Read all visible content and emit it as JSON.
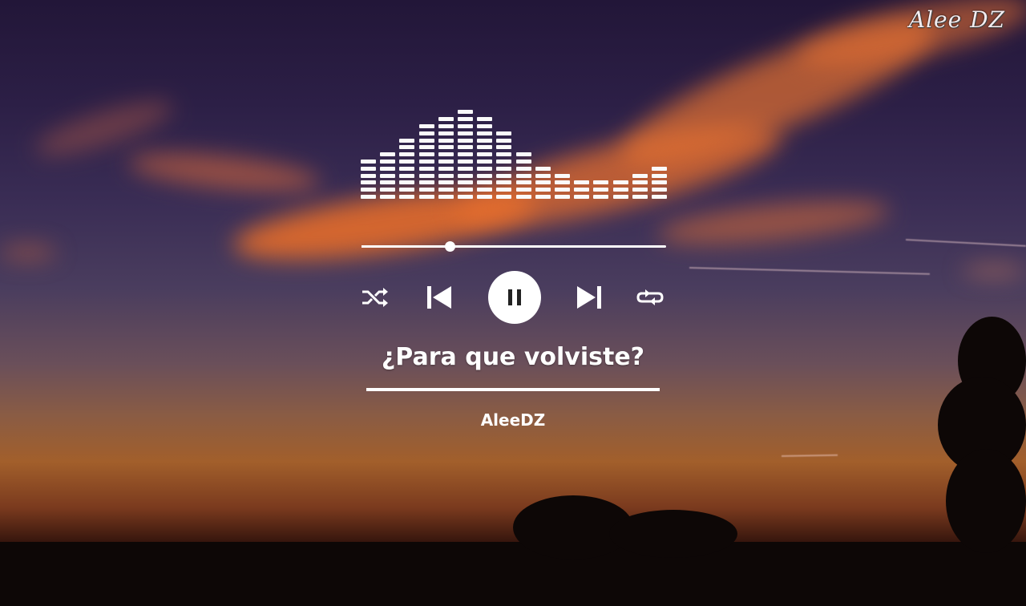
{
  "watermark": "Alee DZ",
  "song": {
    "title": "¿Para que volviste?",
    "artist": "AleeDZ"
  },
  "player": {
    "progress": 0.29,
    "state": "playing",
    "controls": {
      "shuffle_icon": "shuffle-icon",
      "previous_icon": "skip-previous-icon",
      "play_pause_icon": "pause-icon",
      "next_icon": "skip-next-icon",
      "repeat_icon": "repeat-icon"
    }
  },
  "equalizer": {
    "levels": [
      6,
      7,
      9,
      11,
      12,
      13,
      12,
      10,
      7,
      5,
      4,
      3,
      3,
      3,
      4,
      5
    ]
  },
  "colors": {
    "ui": "#ffffff",
    "sky_top": "#221638",
    "sky_horizon": "#a25f2b",
    "cloud": "#e06a2a"
  }
}
